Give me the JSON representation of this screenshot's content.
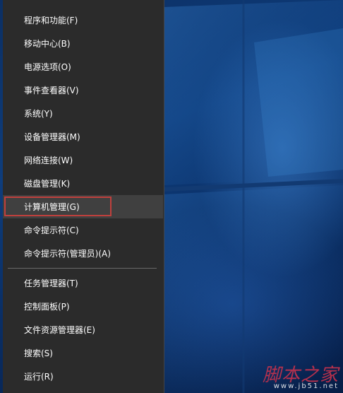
{
  "menu": {
    "group1": [
      {
        "label": "程序和功能(F)"
      },
      {
        "label": "移动中心(B)"
      },
      {
        "label": "电源选项(O)"
      },
      {
        "label": "事件查看器(V)"
      },
      {
        "label": "系统(Y)"
      },
      {
        "label": "设备管理器(M)"
      },
      {
        "label": "网络连接(W)"
      },
      {
        "label": "磁盘管理(K)"
      },
      {
        "label": "计算机管理(G)",
        "highlighted": true
      },
      {
        "label": "命令提示符(C)"
      },
      {
        "label": "命令提示符(管理员)(A)"
      }
    ],
    "group2": [
      {
        "label": "任务管理器(T)"
      },
      {
        "label": "控制面板(P)"
      },
      {
        "label": "文件资源管理器(E)"
      },
      {
        "label": "搜索(S)"
      },
      {
        "label": "运行(R)"
      }
    ]
  },
  "watermark": {
    "main": "脚本之家",
    "sub": "www.jb51.net"
  },
  "colors": {
    "menu_bg": "#2b2b2b",
    "menu_hover": "#404040",
    "highlight_border": "#c0403d",
    "text": "#ffffff",
    "wallpaper": "#0e3d7c"
  }
}
